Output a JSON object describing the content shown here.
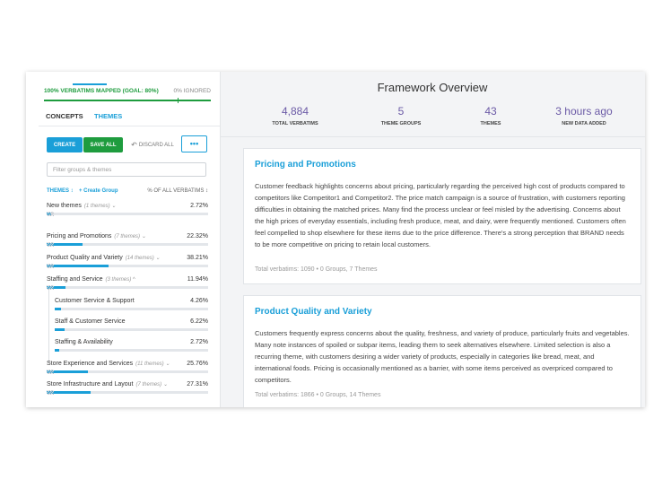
{
  "progress": {
    "mapped_label": "100% VERBATIMS MAPPED (GOAL: 80%)",
    "ignored_label": "0% IGNORED",
    "mapped_fraction": 1.0,
    "goal_fraction": 0.8,
    "color": "#1e9c3e"
  },
  "tabs": [
    {
      "label": "CONCEPTS",
      "active": false
    },
    {
      "label": "THEMES",
      "active": true
    }
  ],
  "toolbar": {
    "create_label": "CREATE",
    "save_all_label": "SAVE ALL",
    "discard_label": "DISCARD ALL",
    "more_label": "•••"
  },
  "filter": {
    "placeholder": "Filter groups & themes"
  },
  "list_header": {
    "themes_label": "THEMES ↕",
    "create_group_label": "+ Create Group",
    "pct_label": "% OF ALL VERBATIMS ↕"
  },
  "rows": [
    {
      "name": "New themes",
      "sub": "(1 themes) ⌄",
      "pct": "2.72%",
      "fraction": 0.0272,
      "indent": false
    },
    {
      "name": "Pricing and Promotions",
      "sub": "(7 themes) ⌄",
      "pct": "22.32%",
      "fraction": 0.2232,
      "indent": false
    },
    {
      "name": "Product Quality and Variety",
      "sub": "(14 themes) ⌄",
      "pct": "38.21%",
      "fraction": 0.3821,
      "indent": false
    },
    {
      "name": "Staffing and Service",
      "sub": "(3 themes) ^",
      "pct": "11.94%",
      "fraction": 0.1194,
      "indent": false
    },
    {
      "name": "Customer Service & Support",
      "sub": "",
      "pct": "4.26%",
      "fraction": 0.0426,
      "indent": true
    },
    {
      "name": "Staff & Customer Service",
      "sub": "",
      "pct": "6.22%",
      "fraction": 0.0622,
      "indent": true
    },
    {
      "name": "Staffing & Availability",
      "sub": "",
      "pct": "2.72%",
      "fraction": 0.0272,
      "indent": true
    },
    {
      "name": "Store Experience and Services",
      "sub": "(11 themes) ⌄",
      "pct": "25.76%",
      "fraction": 0.2576,
      "indent": false
    },
    {
      "name": "Store Infrastructure and Layout",
      "sub": "(7 themes) ⌄",
      "pct": "27.31%",
      "fraction": 0.2731,
      "indent": false
    }
  ],
  "overview": {
    "title": "Framework Overview",
    "stats": [
      {
        "value": "4,884",
        "label": "TOTAL VERBATIMS"
      },
      {
        "value": "5",
        "label": "THEME GROUPS"
      },
      {
        "value": "43",
        "label": "THEMES"
      },
      {
        "value": "3 hours ago",
        "label": "NEW DATA ADDED"
      }
    ]
  },
  "cards": [
    {
      "title": "Pricing and Promotions",
      "body": "Customer feedback highlights concerns about pricing, particularly regarding the perceived high cost of products compared to competitors like Competitor1 and Competitor2. The price match campaign is a source of frustration, with customers reporting difficulties in obtaining the matched prices. Many find the process unclear or feel misled by the advertising. Concerns about the high prices of everyday essentials, including fresh produce, meat, and dairy, were frequently mentioned. Customers often feel compelled to shop elsewhere for these items due to the price difference. There's a strong perception that BRAND needs to be more competitive on pricing to retain local customers.",
      "meta": "Total verbatims: 1090  •  0 Groups, 7 Themes"
    },
    {
      "title": "Product Quality and Variety",
      "body": "Customers frequently express concerns about the quality, freshness, and variety of produce, particularly fruits and vegetables. Many note instances of spoiled or subpar items, leading them to seek alternatives elsewhere. Limited selection is also a recurring theme, with customers desiring a wider variety of products, especially in categories like bread, meat, and international foods. Pricing is occasionally mentioned as a barrier, with some items perceived as overpriced compared to competitors.",
      "meta": "Total verbatims: 1866  •  0 Groups, 14 Themes"
    }
  ],
  "colors": {
    "accent": "#1a9fd8",
    "success": "#1e9c3e",
    "stat_number": "#6b5aa6"
  }
}
